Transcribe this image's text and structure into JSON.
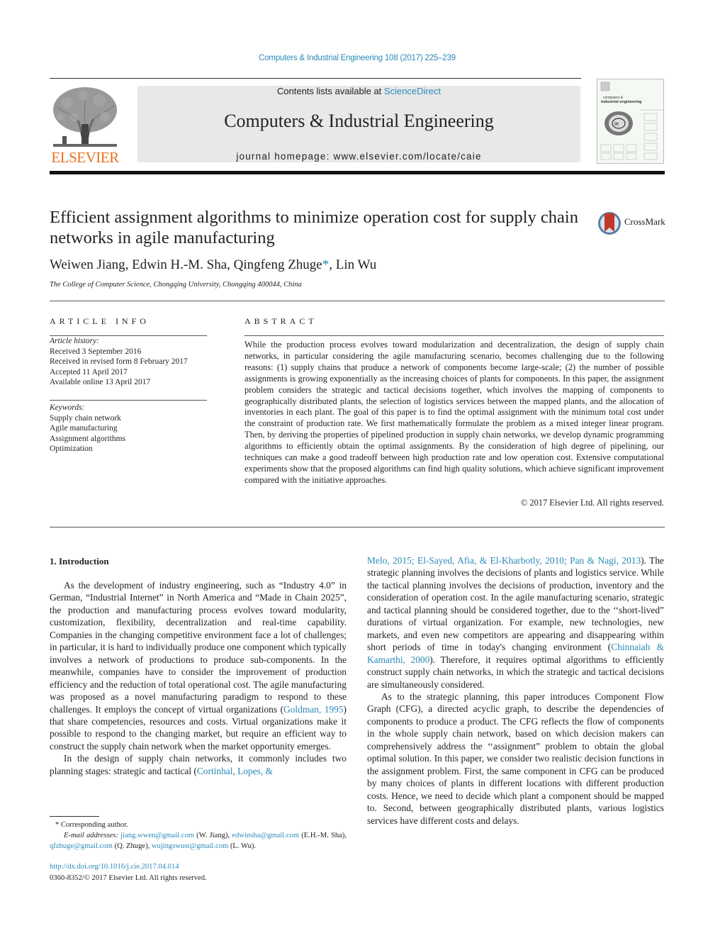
{
  "header": {
    "journal_ref": "Computers & Industrial Engineering 108 (2017) 225–239",
    "contents_prefix": "Contents lists available at ",
    "contents_link": "ScienceDirect",
    "journal_title": "Computers & Industrial Engineering",
    "homepage": "journal homepage: www.elsevier.com/locate/caie",
    "publisher_logo_text": "ELSEVIER",
    "cover_title_line1": "computers &",
    "cover_title_line2": "industrial engineering",
    "cover_logo_text": "ie"
  },
  "article": {
    "title": "Efficient assignment algorithms to minimize operation cost for supply chain networks in agile manufacturing",
    "crossmark_label": "CrossMark",
    "authors_before": "Weiwen Jiang, Edwin H.-M. Sha, Qingfeng Zhuge",
    "corresponding_mark": "*",
    "authors_after": ", Lin Wu",
    "affiliation": "The College of Computer Science, Chongqing University, Chongqing 400044, China"
  },
  "article_info": {
    "heading": "ARTICLE INFO",
    "history_label": "Article history:",
    "history": [
      "Received 3 September 2016",
      "Received in revised form 8 February 2017",
      "Accepted 11 April 2017",
      "Available online 13 April 2017"
    ],
    "keywords_label": "Keywords:",
    "keywords": [
      "Supply chain network",
      "Agile manufacturing",
      "Assignment algorithms",
      "Optimization"
    ]
  },
  "abstract": {
    "heading": "ABSTRACT",
    "text": "While the production process evolves toward modularization and decentralization, the design of supply chain networks, in particular considering the agile manufacturing scenario, becomes challenging due to the following reasons: (1) supply chains that produce a network of components become large-scale; (2) the number of possible assignments is growing exponentially as the increasing choices of plants for components. In this paper, the assignment problem considers the strategic and tactical decisions together, which involves the mapping of components to geographically distributed plants, the selection of logistics services between the mapped plants, and the allocation of inventories in each plant. The goal of this paper is to find the optimal assignment with the minimum total cost under the constraint of production rate. We first mathematically formulate the problem as a mixed integer linear program. Then, by deriving the properties of pipelined production in supply chain networks, we develop dynamic programming algorithms to efficiently obtain the optimal assignments. By the consideration of high degree of pipelining, our techniques can make a good tradeoff between high production rate and low operation cost. Extensive computational experiments show that the proposed algorithms can find high quality solutions, which achieve significant improvement compared with the initiative approaches.",
    "copyright": "© 2017 Elsevier Ltd. All rights reserved."
  },
  "intro": {
    "heading": "1. Introduction",
    "p1_a": "As the development of industry engineering, such as “Industry 4.0” in German, “Industrial Internet” in North America and “Made in Chain 2025”, the production and manufacturing process evolves toward modularity, customization, flexibility, decentralization and real-time capability. Companies in the changing competitive environment face a lot of challenges; in particular, it is hard to individually produce one component which typically involves a network of productions to produce sub-components. In the meanwhile, companies have to consider the improvement of production efficiency and the reduction of total operational cost. The agile manufacturing was proposed as a novel manufacturing paradigm to respond to these challenges. It employs the concept of virtual organizations (",
    "p1_cite": "Goldman, 1995",
    "p1_b": ") that share competencies, resources and costs. Virtual organizations make it possible to respond to the changing market, but require an efficient way to construct the supply chain network when the market opportunity emerges.",
    "p2_a": "In the design of supply chain networks, it commonly includes two planning stages: strategic and tactical (",
    "p2_cite_left": "Cortinhal, Lopes, &",
    "p2_cite_right": "Melo, 2015; El-Sayed, Afia, & El-Kharbotly, 2010; Pan & Nagi, 2013",
    "p2_b": "). The strategic planning involves the decisions of plants and logistics service. While the tactical planning involves the decisions of production, inventory and the consideration of operation cost. In the agile manufacturing scenario, strategic and tactical planning should be considered together, due to the ‘‘short-lived” durations of virtual organization. For example, new technologies, new markets, and even new competitors are appearing and disappearing within short periods of time in today's changing environment (",
    "p2_cite2": "Chinnaiah & Kamarthi, 2000",
    "p2_c": "). Therefore, it requires optimal algorithms to efficiently construct supply chain networks, in which the strategic and tactical decisions are simultaneously considered.",
    "p3": "As to the strategic planning, this paper introduces Component Flow Graph (CFG), a directed acyclic graph, to describe the dependencies of components to produce a product. The CFG reflects the flow of components in the whole supply chain network, based on which decision makers can comprehensively address the ‘‘assignment” problem to obtain the global optimal solution. In this paper, we consider two realistic decision functions in the assignment problem. First, the same component in CFG can be produced by many choices of plants in different locations with different production costs. Hence, we need to decide which plant a component should be mapped to. Second, between geographically distributed plants, various logistics services have different costs and delays."
  },
  "footnotes": {
    "corresponding": "* Corresponding author.",
    "email_label": "E-mail addresses: ",
    "emails": [
      {
        "address": "jiang.wwen@gmail.com",
        "name": " (W. Jiang), "
      },
      {
        "address": "edwinsha@gmail.com",
        "name": " (E.H.-M. Sha), "
      },
      {
        "address": "qfzhuge@gmail.com",
        "name": " (Q. Zhuge), "
      },
      {
        "address": "wujingswust@gmail.com",
        "name": " (L. Wu)."
      }
    ],
    "doi": "http://dx.doi.org/10.1016/j.cie.2017.04.014",
    "issn_copyright": "0360-8352/© 2017 Elsevier Ltd. All rights reserved."
  },
  "colors": {
    "link": "#2a8ab8",
    "elsevier_orange": "#e9711c",
    "masthead_bg": "#e8e8e8"
  }
}
